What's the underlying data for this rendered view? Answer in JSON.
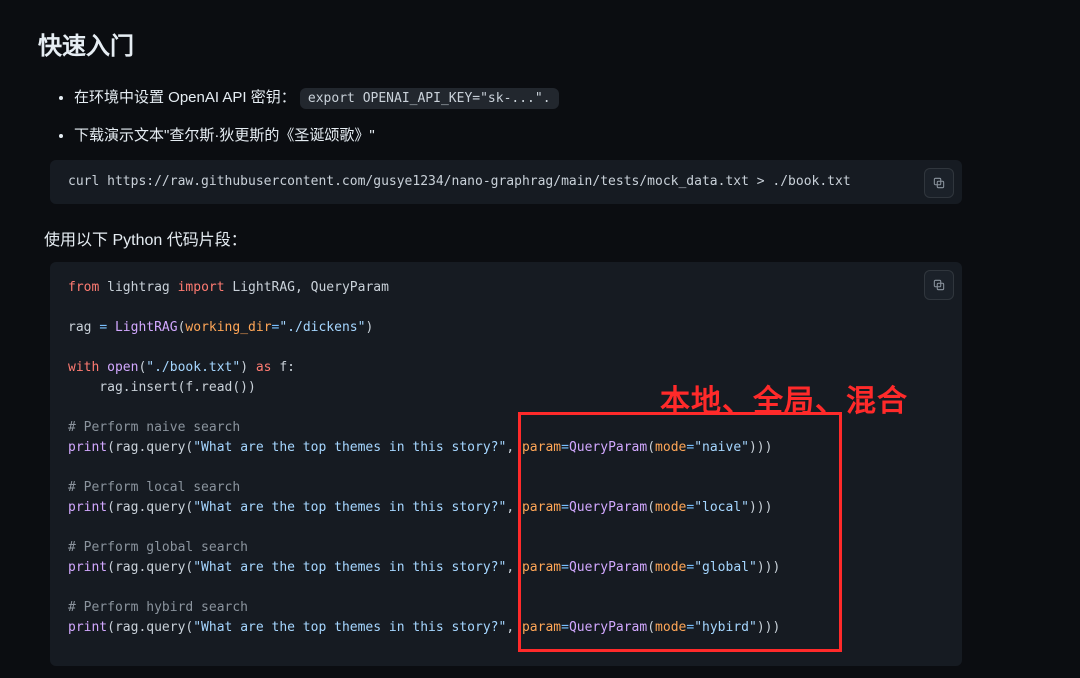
{
  "heading": "快速入门",
  "bullets": {
    "env_prefix": "在环境中设置 OpenAI API 密钥：",
    "env_code": "export OPENAI_API_KEY=\"sk-...\".",
    "demo_text": "下载演示文本\"查尔斯·狄更斯的《圣诞颂歌》\""
  },
  "curl_cmd": "curl https://raw.githubusercontent.com/gusye1234/nano-graphrag/main/tests/mock_data.txt > ./book.txt",
  "sub_heading": "使用以下 Python 代码片段：",
  "py": {
    "l1_from": "from",
    "l1_mod": "lightrag",
    "l1_import": "import",
    "l1_names": "LightRAG, QueryParam",
    "l3_var": "rag",
    "l3_eq": "=",
    "l3_cls": "LightRAG",
    "l3_argk": "working_dir",
    "l3_argeq": "=",
    "l3_argv": "\"./dickens\"",
    "l5_with": "with",
    "l5_open": "open",
    "l5_path": "\"./book.txt\"",
    "l5_as": "as",
    "l5_f": "f:",
    "l6_body": "    rag.insert(f.read())",
    "c1": "# Perform naive search",
    "c2": "# Perform local search",
    "c3": "# Perform global search",
    "c4": "# Perform hybird search",
    "q_prefix_print": "print",
    "q_prefix_rest": "(rag.query(",
    "q_str": "\"What are the top themes in this story?\"",
    "q_sep": ", ",
    "q_paramk": "param",
    "q_eq": "=",
    "q_cls": "QueryParam",
    "q_modek": "mode",
    "mode_naive": "\"naive\"",
    "mode_local": "\"local\"",
    "mode_global": "\"global\"",
    "mode_hybird": "\"hybird\"",
    "q_tail": ")))"
  },
  "annotation_text": "本地、全局、混合",
  "copy_label": "copy"
}
